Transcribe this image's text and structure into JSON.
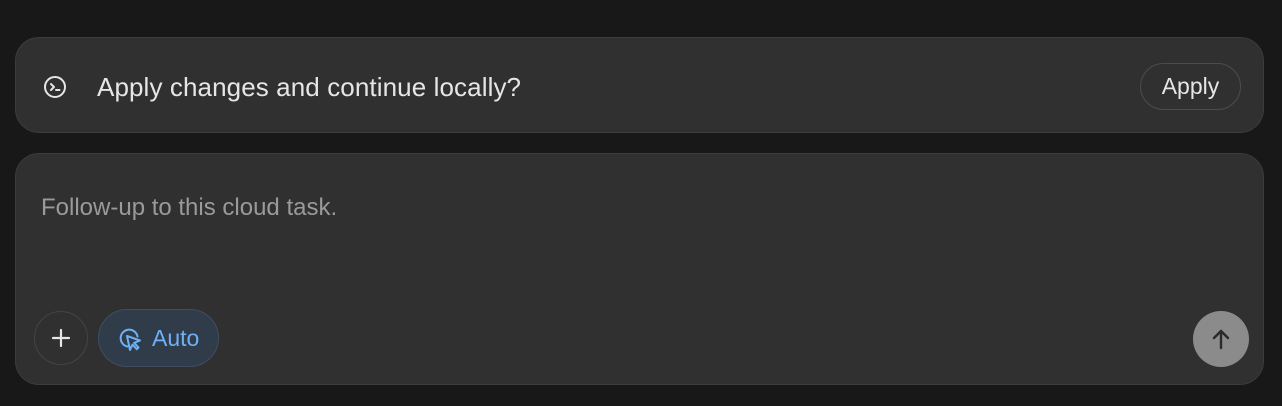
{
  "banner": {
    "icon": "terminal-icon",
    "message": "Apply changes and continue locally?",
    "apply_label": "Apply"
  },
  "composer": {
    "placeholder": "Follow-up to this cloud task.",
    "value": "",
    "add_icon": "plus-icon",
    "mode": {
      "icon": "cursor-click-icon",
      "label": "Auto"
    },
    "send_icon": "arrow-up-icon"
  },
  "colors": {
    "background": "#181818",
    "panel": "#303030",
    "text": "#e6e6e6",
    "placeholder": "#9a9a9a",
    "accent": "#6fb0f5",
    "mode_background": "#313c4b",
    "send_background": "#8b8b8b"
  }
}
